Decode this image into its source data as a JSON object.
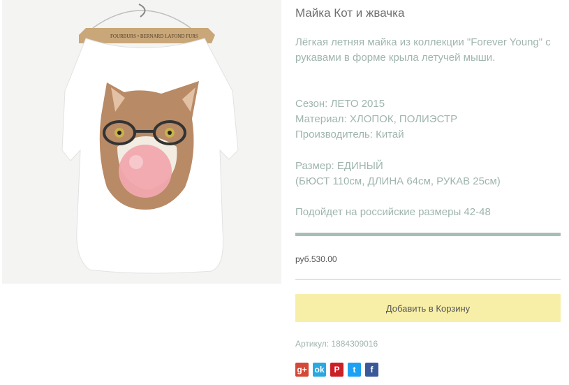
{
  "product": {
    "title": "Майка Кот и жвачка",
    "description": "Лёгкая летняя майка из коллекции \"Forever Young\" с рукавами в форме крыла летучей мыши.",
    "season": "Сезон: ЛЕТО 2015",
    "material": "Материал: ХЛОПОК, ПОЛИЭСТР",
    "manufacturer": "Производитель: Китай",
    "size": "Размер: ЕДИНЫЙ",
    "dimensions": "(БЮСТ 110см, ДЛИНА 64см, РУКАВ 25см)",
    "fit_note": "Подойдет на российские размеры 42-48",
    "price": "руб.530.00",
    "add_to_cart_label": "Добавить в Корзину",
    "sku": "Артикул: 1884309016"
  },
  "image": {
    "hanger_label": "FOURBURS • BERNARD LAFOND FURS"
  },
  "share": [
    {
      "name": "google-plus",
      "glyph": "g+",
      "color": "#d34836"
    },
    {
      "name": "odnoklassniki",
      "glyph": "ok",
      "color": "#2aa9e0"
    },
    {
      "name": "pinterest",
      "glyph": "P",
      "color": "#cb2027"
    },
    {
      "name": "twitter",
      "glyph": "t",
      "color": "#1da1f2"
    },
    {
      "name": "facebook",
      "glyph": "f",
      "color": "#3b5998"
    }
  ]
}
